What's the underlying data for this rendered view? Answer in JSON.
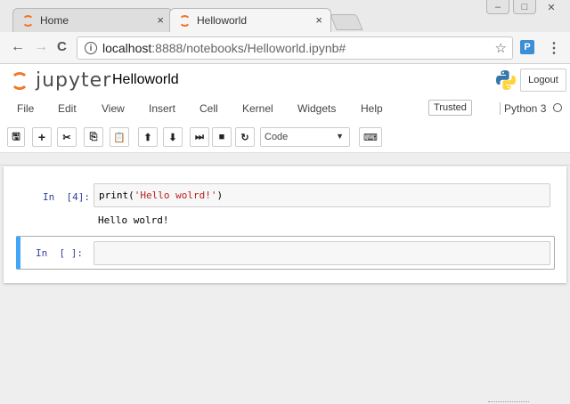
{
  "browser": {
    "tabs": [
      {
        "title": "Home",
        "close": "×"
      },
      {
        "title": "Helloworld",
        "close": "×"
      }
    ],
    "window_controls": {
      "minimize": "–",
      "maximize": "□",
      "close": "✕"
    },
    "nav": {
      "back": "←",
      "forward": "→",
      "reload": "C"
    },
    "url": {
      "info_icon": "i",
      "host": "localhost",
      "path": ":8888/notebooks/Helloworld.ipynb#"
    },
    "bookmark_icon": "☆",
    "extension_label": "P",
    "menu_icon": "⋮"
  },
  "jupyter": {
    "logo_text": "jupyter",
    "notebook_name": "Helloworld",
    "logout_label": "Logout",
    "menu": [
      "File",
      "Edit",
      "View",
      "Insert",
      "Cell",
      "Kernel",
      "Widgets",
      "Help"
    ],
    "trusted_label": "Trusted",
    "kernel_name": "Python 3",
    "toolbar": {
      "save": "🖫",
      "add": "+",
      "cut": "✂",
      "copy": "⎘",
      "paste": "📋",
      "up": "⬆",
      "down": "⬇",
      "run": "⏭",
      "stop": "■",
      "restart": "↻",
      "keyboard": "⌨"
    },
    "cell_type": "Code",
    "cell_type_caret": "▼",
    "cells": [
      {
        "prompt": "In  [4]:",
        "code_prefix": "print(",
        "code_string": "'Hello wolrd!'",
        "code_suffix": ")",
        "output": "Hello wolrd!"
      },
      {
        "prompt": "In  [ ]:",
        "code": ""
      }
    ]
  },
  "colors": {
    "jupyter_orange": "#f37726",
    "prompt_blue": "#303f9f",
    "selected_cell": "#42a5f5",
    "string_red": "#ba2121"
  }
}
